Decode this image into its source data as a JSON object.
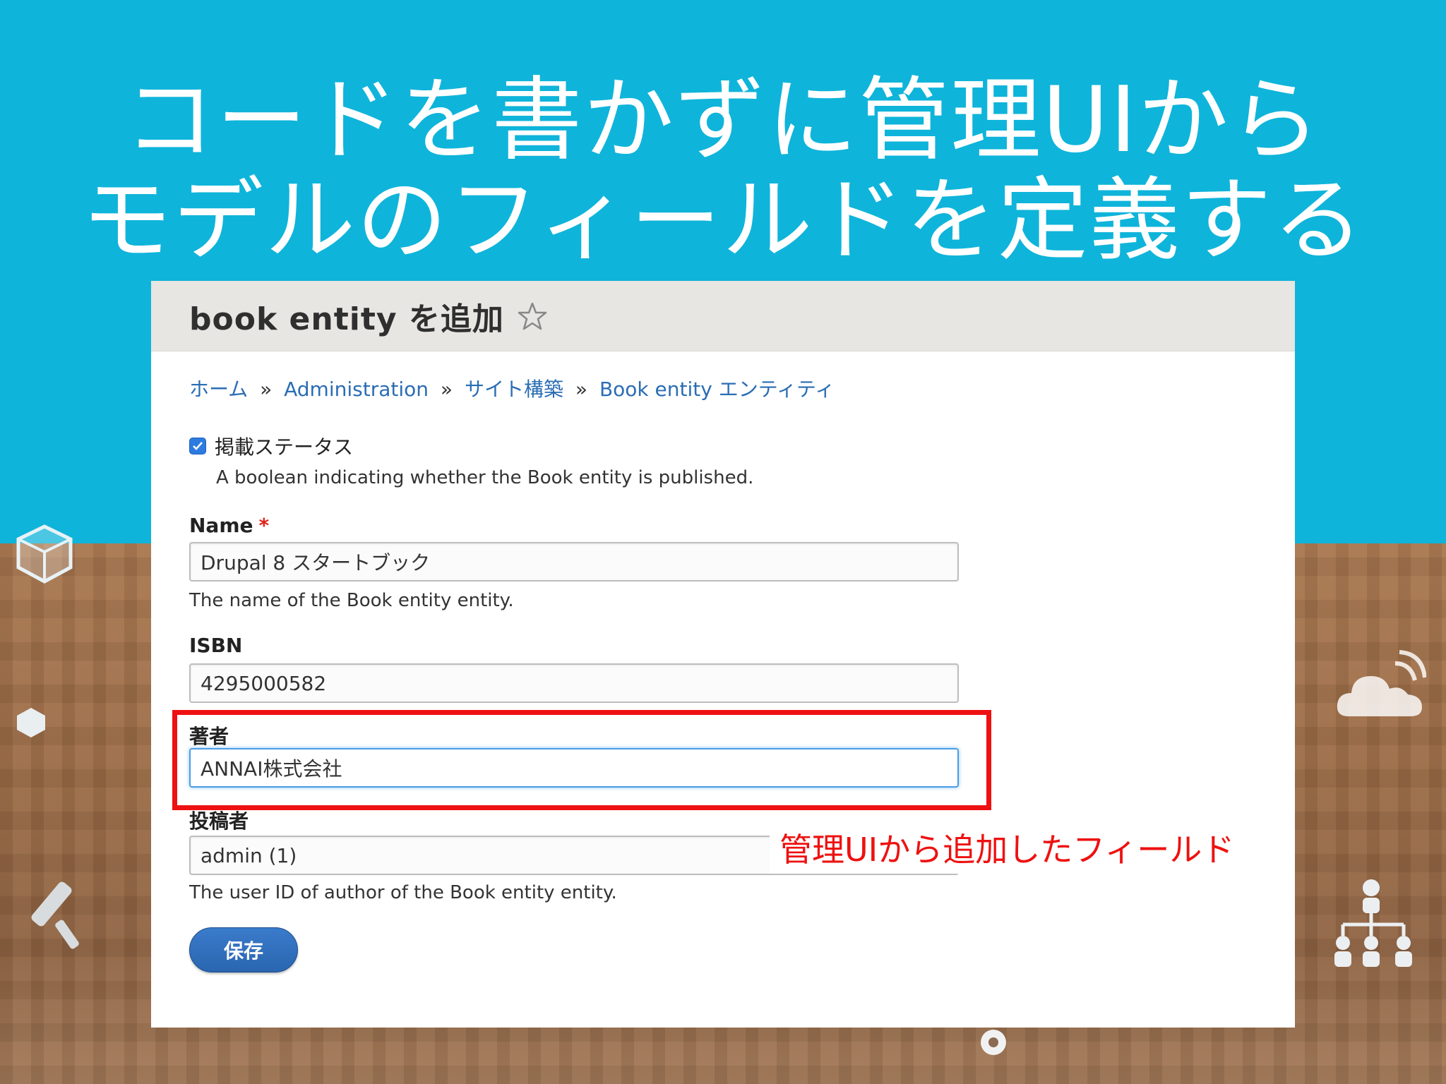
{
  "slide": {
    "title_line1": "コードを書かずに管理UIから",
    "title_line2": "モデルのフィールドを定義する",
    "annotation": "管理UIから追加したフィールド"
  },
  "page": {
    "title": "book entity を追加"
  },
  "breadcrumb": {
    "items": [
      "ホーム",
      "Administration",
      "サイト構築",
      "Book entity エンティティ"
    ],
    "separator": "»"
  },
  "form": {
    "status": {
      "label": "掲載ステータス",
      "checked": true,
      "description": "A boolean indicating whether the Book entity is published."
    },
    "name": {
      "label": "Name",
      "required_mark": "*",
      "value": "Drupal 8 スタートブック",
      "description": "The name of the Book entity entity."
    },
    "isbn": {
      "label": "ISBN",
      "value": "4295000582"
    },
    "author": {
      "label": "著者",
      "value": "ANNAI株式会社"
    },
    "uid": {
      "label": "投稿者",
      "value": "admin (1)",
      "description": "The user ID of author of the Book entity entity."
    },
    "save_label": "保存"
  },
  "colors": {
    "sky": "#0fb4da",
    "link": "#2a6db4",
    "highlight": "#ee1111",
    "button": "#2a66b0"
  }
}
